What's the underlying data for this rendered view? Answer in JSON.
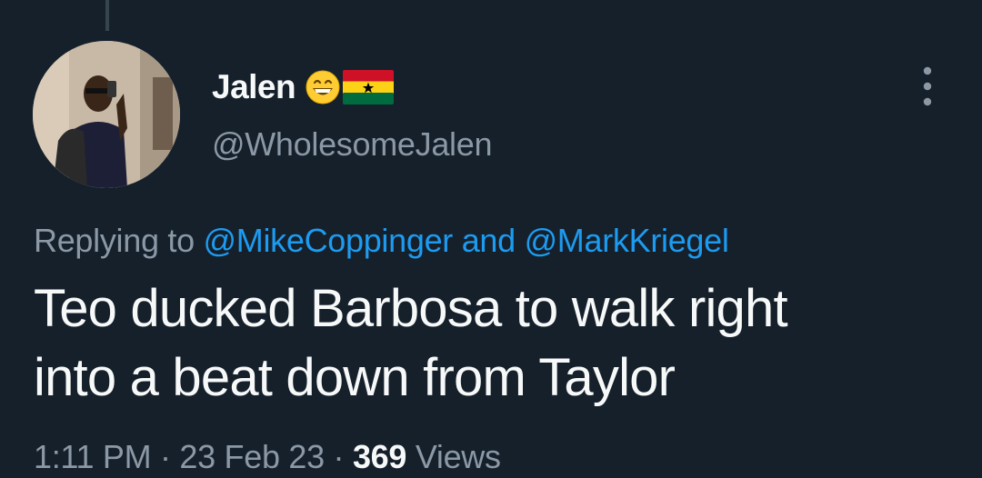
{
  "tweet": {
    "author": {
      "display_name": "Jalen",
      "handle": "@WholesomeJalen",
      "badges": [
        "grinning-face-emoji",
        "ghana-flag-emoji"
      ]
    },
    "reply": {
      "prefix": "Replying to",
      "mention_1": "@MikeCoppinger",
      "conjunction": "and",
      "mention_2": "@MarkKriegel"
    },
    "text_line_1": "Teo ducked Barbosa to walk right",
    "text_line_2": "into a beat down from Taylor",
    "meta": {
      "time": "1:11 PM",
      "separator": "·",
      "date": "23 Feb 23",
      "views_count": "369",
      "views_label": "Views"
    },
    "more_icon": "more-vertical-icon"
  },
  "colors": {
    "background": "#15202b",
    "text_primary": "#f7f9f9",
    "text_secondary": "#8b98a5",
    "link": "#1d9bf0"
  }
}
